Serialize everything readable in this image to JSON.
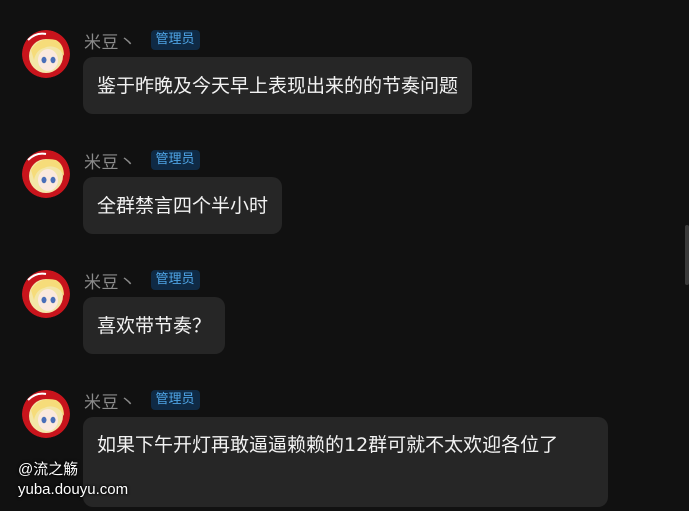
{
  "messages": [
    {
      "name": "米豆丶",
      "badge": "管理员",
      "text": "鉴于昨晚及今天早上表现出来的的节奏问题"
    },
    {
      "name": "米豆丶",
      "badge": "管理员",
      "text": "全群禁言四个半小时"
    },
    {
      "name": "米豆丶",
      "badge": "管理员",
      "text": "喜欢带节奏？"
    },
    {
      "name": "米豆丶",
      "badge": "管理员",
      "text": "如果下午开灯再敢逼逼赖赖的12群可就不太欢迎各位了"
    }
  ],
  "watermark": {
    "user": "@流之觞",
    "site": "yuba.douyu.com"
  },
  "colors": {
    "background": "#111111",
    "bubble": "#262626",
    "badge_bg": "#0f2a45",
    "badge_text": "#4fa5e6",
    "name": "#8a8a8a"
  },
  "icons": {
    "avatar": "anime-avatar-icon"
  }
}
